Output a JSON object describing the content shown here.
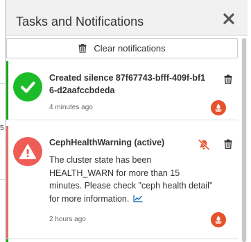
{
  "header": {
    "title": "Tasks and Notifications",
    "close_icon": "close-icon"
  },
  "toolbar": {
    "clear_label": "Clear notifications",
    "clear_icon": "trash-icon"
  },
  "background": {
    "edge_mark": "5"
  },
  "notifications": [
    {
      "status": "success",
      "status_icon": "check-circle-icon",
      "title": "Created silence 87f67743-bfff-409f-bf16-d2aafccbdeda",
      "time": "4 minutes ago",
      "app_icon": "prometheus-icon",
      "bar_color": "#19a519",
      "icon_color": "#1cbc29"
    },
    {
      "status": "warning",
      "status_icon": "warning-triangle-icon",
      "title": "CephHealthWarning (active)",
      "message": "The cluster state has been HEALTH_WARN for more than 15 minutes. Please check \"ceph health detail\" for more information.",
      "time": "2 hours ago",
      "app_icon": "prometheus-icon",
      "bar_color": "#e36b6b",
      "icon_color": "#ef5c55",
      "mute_icon": "bell-slash-icon",
      "link_icon": "line-chart-icon"
    }
  ],
  "colors": {
    "prometheus": "#e6522c",
    "link": "#2b7ab8",
    "mute": "#e8522c"
  }
}
